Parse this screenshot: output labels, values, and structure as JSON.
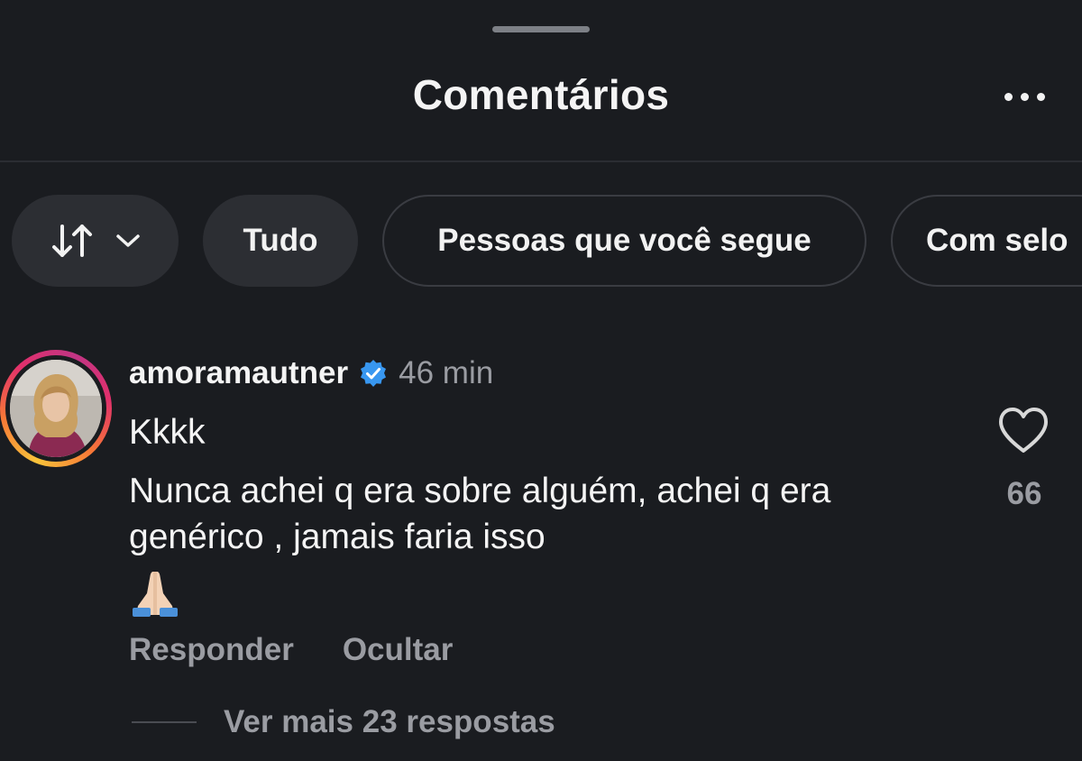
{
  "sheet": {
    "title": "Comentários",
    "more_icon": "more-horizontal-icon"
  },
  "filters": {
    "sort_icon": "sort-arrows-icon",
    "dropdown_icon": "chevron-down-icon",
    "chips": [
      {
        "label": "Tudo",
        "selected": true
      },
      {
        "label": "Pessoas que você segue",
        "selected": false
      },
      {
        "label": "Com selo",
        "selected": false
      }
    ]
  },
  "comment": {
    "username": "amoramautner",
    "verified_icon": "verified-badge-icon",
    "time": "46 min",
    "line1": "Kkkk",
    "line2": "Nunca achei q era sobre alguém, achei q era genérico , jamais faria isso",
    "emoji_icon": "folded-hands-emoji",
    "like_icon": "heart-outline-icon",
    "like_count": "66",
    "reply_label": "Responder",
    "hide_label": "Ocultar",
    "view_replies": "Ver mais 23 respostas"
  },
  "colors": {
    "background": "#1a1c20",
    "chip_fill": "#2c2e33",
    "secondary_text": "#9a9ca2",
    "verified_blue": "#3897f0"
  }
}
